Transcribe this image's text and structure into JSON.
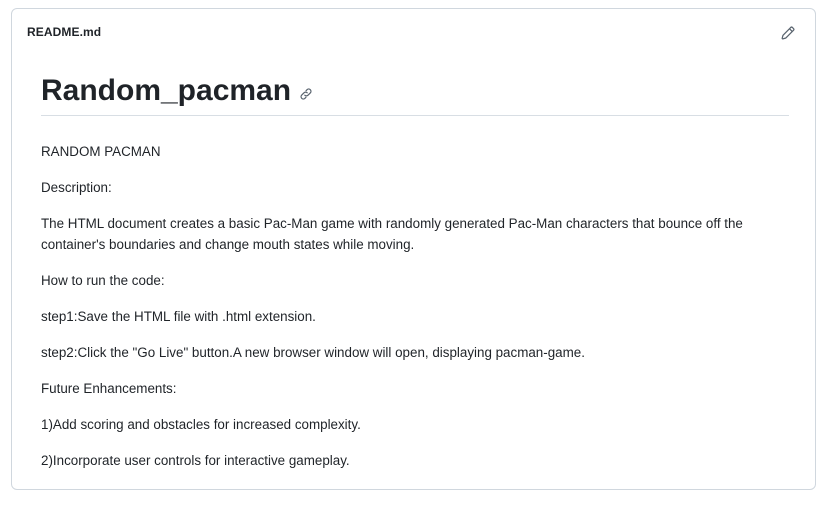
{
  "file": {
    "name": "README.md"
  },
  "icons": {
    "edit": "pencil-icon",
    "anchor": "link-icon"
  },
  "readme": {
    "title": "Random_pacman",
    "paragraphs": [
      "RANDOM PACMAN",
      "Description:",
      "The HTML document creates a basic Pac-Man game with randomly generated Pac-Man characters that bounce off the container's boundaries and change mouth states while moving.",
      "How to run the code:",
      "step1:Save the HTML file with .html extension.",
      "step2:Click the \"Go Live\" button.A new browser window will open, displaying pacman-game.",
      "Future Enhancements:",
      "1)Add scoring and obstacles for increased complexity.",
      "2)Incorporate user controls for interactive gameplay."
    ]
  },
  "colors": {
    "border": "#d0d7de",
    "text": "#1f2328",
    "icon": "#59636e"
  }
}
